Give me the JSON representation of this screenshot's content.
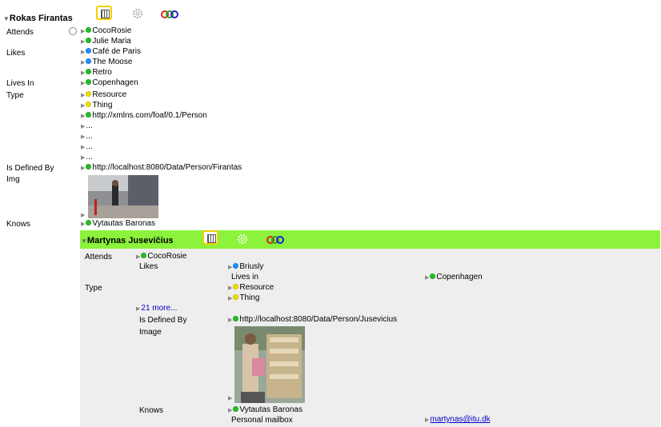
{
  "person": {
    "name": "Rokas Firantas",
    "attends": [
      "CocoRosie",
      "Julie Maria"
    ],
    "likes": [
      "Café de Paris",
      "The Moose",
      "Retro"
    ],
    "lives_in": "Copenhagen",
    "type": [
      "Resource",
      "Thing",
      "http://xmlns.com/foaf/0.1/Person",
      "...",
      "...",
      "...",
      "..."
    ],
    "is_defined_by": "http://localhost:8080/Data/Person/Firantas",
    "knows": "Vytautas Baronas"
  },
  "labels": {
    "attends": "Attends",
    "likes": "Likes",
    "lives_in": "Lives In",
    "type": "Type",
    "is_defined_by": "Is Defined By",
    "img": "Img",
    "knows": "Knows"
  },
  "nested": {
    "name": "Martynas Jusevičius",
    "labels": {
      "attends": "Attends",
      "likes": "Likes",
      "lives_in": "Lives in",
      "type": "Type",
      "is_defined_by": "Is Defined By",
      "image": "Image",
      "knows": "Knows",
      "mailbox": "Personal mailbox"
    },
    "attends": "CocoRosie",
    "likes": "Briusly",
    "lives_in": "Copenhagen",
    "type": [
      "Resource",
      "Thing"
    ],
    "more": "21 more...",
    "is_defined_by": "http://localhost:8080/Data/Person/Jusevicius",
    "knows": "Vytautas Baronas",
    "mailbox": "martynas@itu.dk"
  },
  "colors": {
    "green_header": "#8cf23c",
    "panel": "#eeeeee",
    "button_border": "#f0d000",
    "link": "#0000cc"
  },
  "icons": [
    "view-table-icon",
    "gear-icon",
    "rings-icon",
    "expand-triangle-icon",
    "node-dot-icon"
  ]
}
